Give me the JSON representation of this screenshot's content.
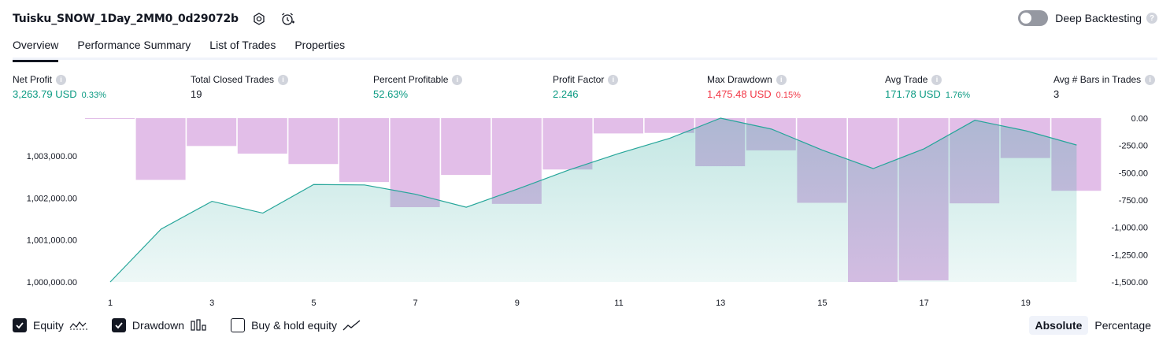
{
  "header": {
    "title": "Tuisku_SNOW_1Day_2MM0_0d29072b",
    "settings_icon": "settings-hex-icon",
    "alert_icon": "add-alert-clock-icon"
  },
  "deep_backtesting": {
    "label": "Deep Backtesting",
    "enabled": false,
    "help": "?"
  },
  "tabs": [
    "Overview",
    "Performance Summary",
    "List of Trades",
    "Properties"
  ],
  "active_tab": "Overview",
  "metrics": [
    {
      "label": "Net Profit",
      "value": "3,263.79 USD",
      "pct": "0.33%",
      "color": "green"
    },
    {
      "label": "Total Closed Trades",
      "value": "19",
      "pct": "",
      "color": "black"
    },
    {
      "label": "Percent Profitable",
      "value": "52.63%",
      "pct": "",
      "color": "green"
    },
    {
      "label": "Profit Factor",
      "value": "2.246",
      "pct": "",
      "color": "green"
    },
    {
      "label": "Max Drawdown",
      "value": "1,475.48 USD",
      "pct": "0.15%",
      "color": "red"
    },
    {
      "label": "Avg Trade",
      "value": "171.78 USD",
      "pct": "1.76%",
      "color": "green"
    },
    {
      "label": "Avg # Bars in Trades",
      "value": "3",
      "pct": "",
      "color": "black"
    }
  ],
  "info_glyph": "i",
  "chart_data": {
    "type": "line",
    "x": [
      1,
      2,
      3,
      4,
      5,
      6,
      7,
      8,
      9,
      10,
      11,
      12,
      13,
      14,
      15,
      16,
      17,
      18,
      19,
      20
    ],
    "x_ticks": [
      1,
      3,
      5,
      7,
      9,
      11,
      13,
      15,
      17,
      19
    ],
    "series": [
      {
        "axis": "left",
        "style": "area",
        "color": "#26a69a",
        "values": [
          1000000,
          1001260,
          1001920,
          1001640,
          1002320,
          1002310,
          1002090,
          1001780,
          1002210,
          1002660,
          1003060,
          1003420,
          1003900,
          1003640,
          1003140,
          1002700,
          1003170,
          1003850,
          1003600,
          1003260
        ]
      },
      {
        "axis": "right",
        "style": "bar",
        "color": "#ce93d8",
        "values": [
          0,
          -565,
          -255,
          -325,
          -420,
          -585,
          -815,
          -520,
          -785,
          -470,
          -140,
          -135,
          -440,
          -295,
          -775,
          -1500,
          -1485,
          -780,
          -365,
          -665
        ]
      }
    ],
    "left_ticks": [
      "1,000,000.00",
      "1,001,000.00",
      "1,002,000.00",
      "1,003,000.00"
    ],
    "right_ticks": [
      "0.00",
      "-250.00",
      "-500.00",
      "-750.00",
      "-1,000.00",
      "-1,250.00",
      "-1,500.00"
    ],
    "ylim_left": [
      1000000,
      1003900
    ],
    "ylim_right": [
      -1500,
      0
    ]
  },
  "legend": [
    {
      "label": "Equity",
      "checked": true,
      "icon": "equity-wave-icon"
    },
    {
      "label": "Drawdown",
      "checked": true,
      "icon": "drawdown-bars-icon"
    },
    {
      "label": "Buy & hold equity",
      "checked": false,
      "icon": "buy-hold-line-icon"
    }
  ],
  "modes": [
    "Absolute",
    "Percentage"
  ],
  "active_mode": "Absolute"
}
